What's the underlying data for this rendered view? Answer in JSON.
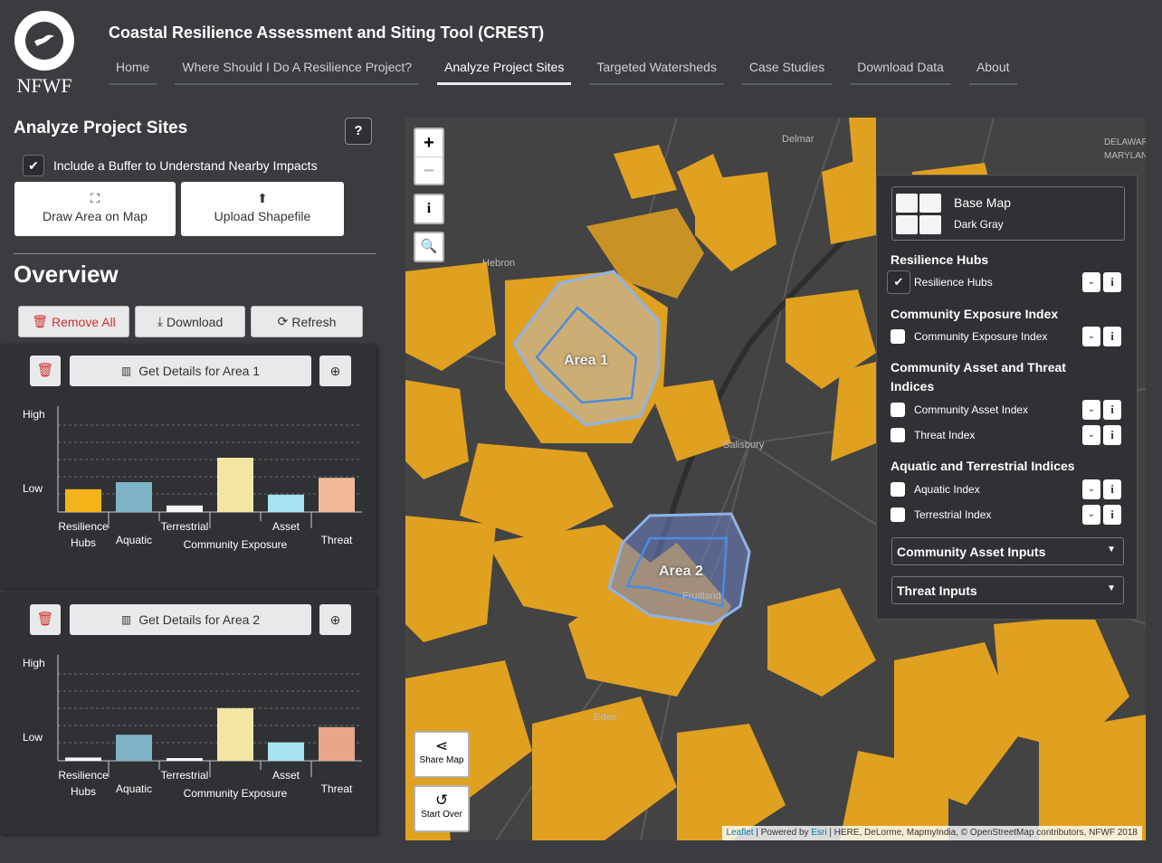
{
  "header": {
    "logo_text": "NFWF",
    "title": "Coastal Resilience Assessment and Siting Tool (CREST)",
    "nav": [
      "Home",
      "Where Should I Do A Resilience Project?",
      "Analyze Project Sites",
      "Targeted Watersheds",
      "Case Studies",
      "Download Data",
      "About"
    ],
    "active_nav": "Analyze Project Sites"
  },
  "panel": {
    "title": "Analyze Project Sites",
    "help_label": "?",
    "buffer_label": "Include a Buffer to Understand Nearby Impacts",
    "buffer_checked": true,
    "draw_label": "Draw Area on Map",
    "upload_label": "Upload Shapefile",
    "overview_title": "Overview",
    "remove_all_label": "Remove All",
    "download_label": "Download",
    "refresh_label": "Refresh"
  },
  "areas": [
    {
      "details_label": "Get Details for Area 1",
      "chart_data": {
        "type": "bar",
        "ylabel_high": "High",
        "ylabel_low": "Low",
        "categories": [
          "Resilience Hubs",
          "Aquatic",
          "Terrestrial",
          "Community Exposure",
          "Asset",
          "Threat"
        ],
        "values": [
          0.42,
          0.55,
          0.12,
          1.0,
          0.32,
          0.63
        ],
        "colors": [
          "#f2b418",
          "#7fb3c8",
          "#f5f5f5",
          "#f3e6a3",
          "#a9e3ef",
          "#f0b99a"
        ]
      }
    },
    {
      "details_label": "Get Details for Area 2",
      "chart_data": {
        "type": "bar",
        "ylabel_high": "High",
        "ylabel_low": "Low",
        "categories": [
          "Resilience Hubs",
          "Aquatic",
          "Terrestrial",
          "Community Exposure",
          "Asset",
          "Threat"
        ],
        "values": [
          0.06,
          0.48,
          0.0,
          0.97,
          0.34,
          0.62
        ],
        "colors": [
          "#f5f5f5",
          "#7fb3c8",
          "#f5f5f5",
          "#f3e6a3",
          "#a9e3ef",
          "#e9a688"
        ]
      }
    }
  ],
  "map": {
    "zoom_in": "+",
    "zoom_out": "−",
    "info": "i",
    "share_label": "Share Map",
    "start_over_label": "Start Over",
    "places": [
      "Delmar",
      "DELAWARE",
      "MARYLAND",
      "Hebron",
      "Salisbury",
      "Fruitland",
      "Eden"
    ],
    "area_labels": [
      "Area 1",
      "Area 2"
    ],
    "attribution": {
      "leaflet": "Leaflet",
      "powered": "| Powered by",
      "esri": "Esri",
      "rest": "| HERE, DeLorme, MapmyIndia, © OpenStreetMap contributors, NFWF 2018"
    },
    "hub_color": "#e0a020"
  },
  "layers": {
    "basemap_title": "Base Map",
    "basemap_value": "Dark Gray",
    "sections": [
      {
        "title": "Resilience Hubs",
        "items": [
          {
            "name": "Resilience Hubs",
            "checked": true
          }
        ]
      },
      {
        "title": "Community Exposure Index",
        "items": [
          {
            "name": "Community Exposure Index",
            "checked": false
          }
        ]
      },
      {
        "title": "Community Asset and Threat Indices",
        "items": [
          {
            "name": "Community Asset Index",
            "checked": false
          },
          {
            "name": "Threat Index",
            "checked": false
          }
        ]
      },
      {
        "title": "Aquatic and Terrestrial Indices",
        "items": [
          {
            "name": "Aquatic Index",
            "checked": false
          },
          {
            "name": "Terrestrial Index",
            "checked": false
          }
        ]
      }
    ],
    "dropdowns": [
      "Community Asset Inputs",
      "Threat Inputs"
    ]
  }
}
